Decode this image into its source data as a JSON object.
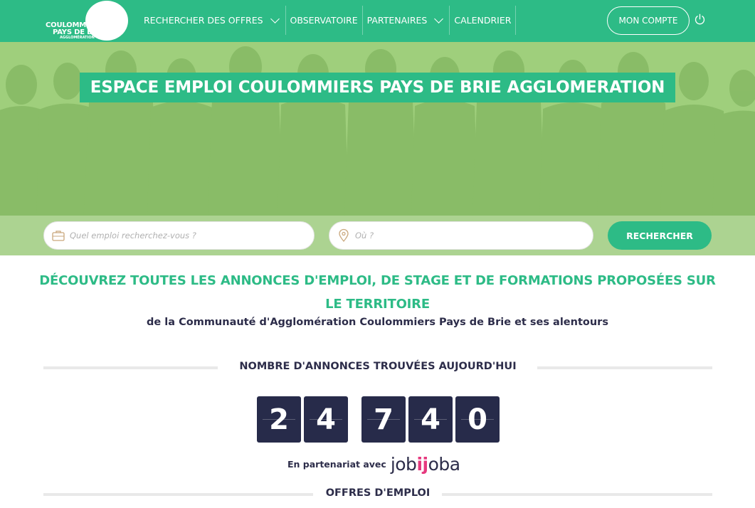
{
  "header": {
    "logo": {
      "line1": "COULOMMIERS",
      "line2": "PAYS DE BRIE",
      "line3": "AGGLOMÉRATION"
    },
    "nav": [
      {
        "label": "RECHERCHER DES OFFRES",
        "has_dropdown": true
      },
      {
        "label": "OBSERVATOIRE",
        "has_dropdown": false
      },
      {
        "label": "PARTENAIRES",
        "has_dropdown": true
      },
      {
        "label": "CALENDRIER",
        "has_dropdown": false
      }
    ],
    "account_label": "MON COMPTE",
    "power_icon": "power-icon"
  },
  "hero": {
    "title": "ESPACE EMPLOI COULOMMIERS PAYS DE BRIE AGGLOMERATION",
    "search": {
      "job_placeholder": "Quel emploi recherchez-vous ?",
      "location_placeholder": "Où ?",
      "button_label": "RECHERCHER"
    }
  },
  "main": {
    "headline": "DÉCOUVREZ TOUTES LES ANNONCES D'EMPLOI, DE STAGE ET DE FORMATIONS PROPOSÉES SUR LE TERRITOIRE",
    "subline": "de la Communauté d'Agglomération Coulommiers Pays de Brie et ses alentours",
    "count_section_title": "NOMBRE D'ANNONCES TROUVÉES AUJOURD'HUI",
    "counter_groups": [
      [
        "2",
        "4"
      ],
      [
        "7",
        "4",
        "0"
      ]
    ],
    "partner_text": "En partenariat avec",
    "partner_logo": {
      "part1": "job",
      "part2": "ij",
      "part3": "oba"
    },
    "offers_section_title": "OFFRES D'EMPLOI"
  },
  "colors": {
    "primary": "#2dbb86",
    "dark": "#272b4a",
    "hero_bg": "#9fcf7c",
    "accent_pink": "#e6387e"
  }
}
